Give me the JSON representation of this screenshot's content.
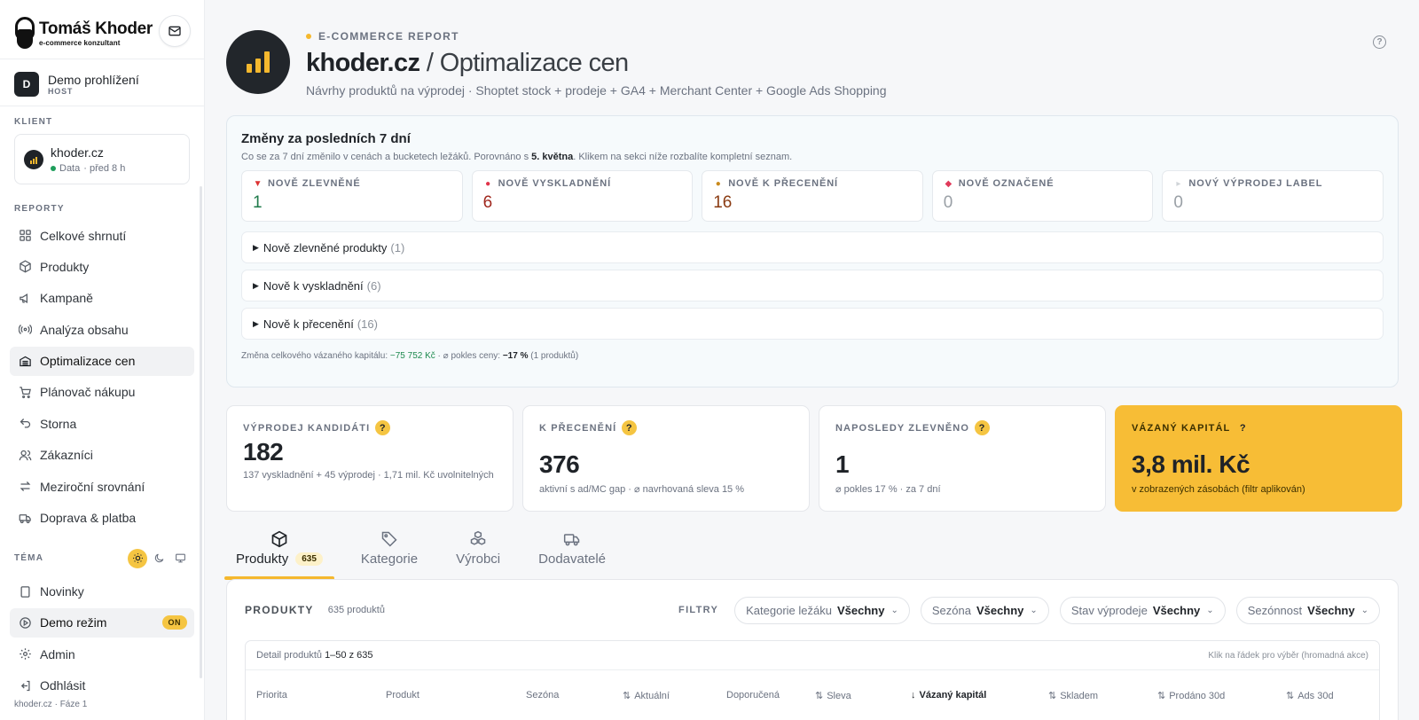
{
  "brand": {
    "name": "Tomáš Khoder",
    "sub": "e-commerce konzultant"
  },
  "demo": {
    "avatar": "D",
    "title": "Demo prohlížení",
    "role": "HOST"
  },
  "client": {
    "section": "KLIENT",
    "name": "khoder.cz",
    "status": "Data",
    "updated": "· před 8 h"
  },
  "reports": {
    "section": "REPORTY",
    "items": [
      {
        "label": "Celkové shrnutí",
        "icon": "grid-icon"
      },
      {
        "label": "Produkty",
        "icon": "box-icon"
      },
      {
        "label": "Kampaně",
        "icon": "megaphone-icon"
      },
      {
        "label": "Analýza obsahu",
        "icon": "broadcast-icon"
      },
      {
        "label": "Optimalizace cen",
        "icon": "warehouse-icon",
        "active": true
      },
      {
        "label": "Plánovač nákupu",
        "icon": "cart-icon"
      },
      {
        "label": "Storna",
        "icon": "undo-icon"
      },
      {
        "label": "Zákazníci",
        "icon": "users-icon"
      },
      {
        "label": "Meziroční srovnání",
        "icon": "arrows-icon"
      },
      {
        "label": "Doprava & platba",
        "icon": "truck-icon"
      }
    ]
  },
  "theme": {
    "section": "TÉMA"
  },
  "bottom_nav": {
    "news": "Novinky",
    "demo_mode": "Demo režim",
    "demo_badge": "ON",
    "admin": "Admin",
    "logout": "Odhlásit"
  },
  "footer": "khoder.cz · Fáze 1",
  "header": {
    "kicker": "E-COMMERCE REPORT",
    "site": "khoder.cz",
    "title_rest": "/ Optimalizace cen",
    "subtitle": "Návrhy produktů na výprodej · Shoptet stock + prodeje + GA4 + Merchant Center + Google Ads Shopping"
  },
  "changes": {
    "title": "Změny za posledních 7 dní",
    "desc_before": "Co se za 7 dní změnilo v cenách a bucketech ležáků. Porovnáno s ",
    "desc_date": "5. května",
    "desc_after": ". Klikem na sekci níže rozbalíte kompletní seznam.",
    "kpis": [
      {
        "label": "NOVĚ ZLEVNĚNÉ",
        "value": "1",
        "color": "#1e7a4a",
        "icon": "down-triangle-icon"
      },
      {
        "label": "NOVĚ VYSKLADNĚNÍ",
        "value": "6",
        "color": "#a0281e",
        "icon": "red-circle-icon"
      },
      {
        "label": "NOVĚ K PŘECENĚNÍ",
        "value": "16",
        "color": "#8a3b12",
        "icon": "money-bag-icon"
      },
      {
        "label": "NOVĚ OZNAČENÉ",
        "value": "0",
        "color": "#9aa0a6",
        "icon": "tag-icon"
      },
      {
        "label": "NOVÝ VÝPRODEJ LABEL",
        "value": "0",
        "color": "#9aa0a6",
        "icon": "label-icon"
      }
    ],
    "sections": [
      {
        "label": "Nově zlevněné produkty",
        "count": "(1)"
      },
      {
        "label": "Nově k vyskladnění",
        "count": "(6)"
      },
      {
        "label": "Nově k přecenění",
        "count": "(16)"
      }
    ],
    "foot_label": "Změna celkového vázaného kapitálu: ",
    "foot_capital": "−75 752 Kč",
    "foot_mid": " · ⌀ pokles ceny: ",
    "foot_drop": "−17 %",
    "foot_tail": " (1 produktů)"
  },
  "kpis": [
    {
      "label": "VÝPRODEJ KANDIDÁTI",
      "value": "182",
      "sub": "137 vyskladnění + 45 výprodej · 1,71 mil. Kč uvolnitelných"
    },
    {
      "label": "K PŘECENĚNÍ",
      "value": "376",
      "sub": "aktivní s ad/MC gap · ⌀ navrhovaná sleva 15 %"
    },
    {
      "label": "NAPOSLEDY ZLEVNĚNO",
      "value": "1",
      "sub": "⌀ pokles 17 % · za 7 dní"
    },
    {
      "label": "VÁZANÝ KAPITÁL",
      "value": "3,8 mil. Kč",
      "sub": "v zobrazených zásobách (filtr aplikován)"
    }
  ],
  "tabs": [
    {
      "label": "Produkty",
      "badge": "635",
      "icon": "cube-icon"
    },
    {
      "label": "Kategorie",
      "icon": "tag-icon"
    },
    {
      "label": "Výrobci",
      "icon": "boxes-icon"
    },
    {
      "label": "Dodavatelé",
      "icon": "truck-icon"
    }
  ],
  "panel": {
    "title": "PRODUKTY",
    "count": "635 produktů",
    "filters_label": "FILTRY",
    "filters": [
      {
        "label": "Kategorie ležáku",
        "value": "Všechny"
      },
      {
        "label": "Sezóna",
        "value": "Všechny"
      },
      {
        "label": "Stav výprodeje",
        "value": "Všechny"
      },
      {
        "label": "Sezónnost",
        "value": "Všechny"
      }
    ],
    "detail_label": "Detail produktů ",
    "detail_range": "1–50 z 635",
    "hint": "Klik na řádek pro výběr (hromadná akce)",
    "columns": [
      {
        "label": "Priorita",
        "sort": ""
      },
      {
        "label": "Produkt",
        "sort": ""
      },
      {
        "label": "Sezóna",
        "sort": ""
      },
      {
        "label": "Aktuální",
        "sort": "⇅"
      },
      {
        "label": "Doporučená",
        "sort": ""
      },
      {
        "label": "Sleva",
        "sort": "⇅"
      },
      {
        "label": "Vázaný kapitál",
        "sort": "↓"
      },
      {
        "label": "Skladem",
        "sort": "⇅"
      },
      {
        "label": "Prodáno 30d",
        "sort": "⇅"
      },
      {
        "label": "Ads 30d",
        "sort": "⇅"
      }
    ]
  }
}
